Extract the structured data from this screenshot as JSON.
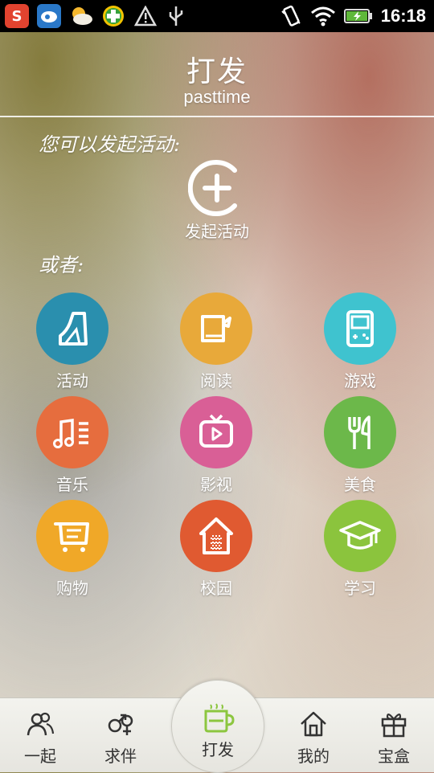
{
  "status_bar": {
    "time": "16:18",
    "notification_icons": [
      "sogou-input-icon",
      "sina-weibo-icon",
      "weather-icon",
      "360-security-icon",
      "warning-icon",
      "usb-icon"
    ],
    "system_icons": [
      "vibrate-icon",
      "wifi-icon",
      "battery-charging-icon"
    ]
  },
  "header": {
    "title": "打发",
    "subtitle": "pasttime"
  },
  "intro_text": "您可以发起活动:",
  "start_button": {
    "label": "发起活动",
    "icon": "plus-circle-icon"
  },
  "or_text": "或者:",
  "categories": [
    {
      "label": "活动",
      "color": "#2a8fae",
      "icon": "boot-icon"
    },
    {
      "label": "阅读",
      "color": "#e8a93a",
      "icon": "book-icon"
    },
    {
      "label": "游戏",
      "color": "#3fc3cf",
      "icon": "gameboy-icon"
    },
    {
      "label": "音乐",
      "color": "#e66d3e",
      "icon": "music-note-icon"
    },
    {
      "label": "影视",
      "color": "#d95f96",
      "icon": "tv-icon"
    },
    {
      "label": "美食",
      "color": "#6cb84a",
      "icon": "fork-knife-icon"
    },
    {
      "label": "购物",
      "color": "#f0a828",
      "icon": "shopping-cart-icon"
    },
    {
      "label": "校园",
      "color": "#e05a31",
      "icon": "school-house-icon"
    },
    {
      "label": "学习",
      "color": "#8bc43d",
      "icon": "graduation-cap-icon"
    }
  ],
  "tab_bar": [
    {
      "label": "一起",
      "icon": "people-icon"
    },
    {
      "label": "求伴",
      "icon": "gender-icon"
    },
    {
      "label": "打发",
      "icon": "coffee-cup-icon",
      "active": true,
      "active_color": "#8cc63f"
    },
    {
      "label": "我的",
      "icon": "home-icon"
    },
    {
      "label": "宝盒",
      "icon": "gift-box-icon"
    }
  ]
}
